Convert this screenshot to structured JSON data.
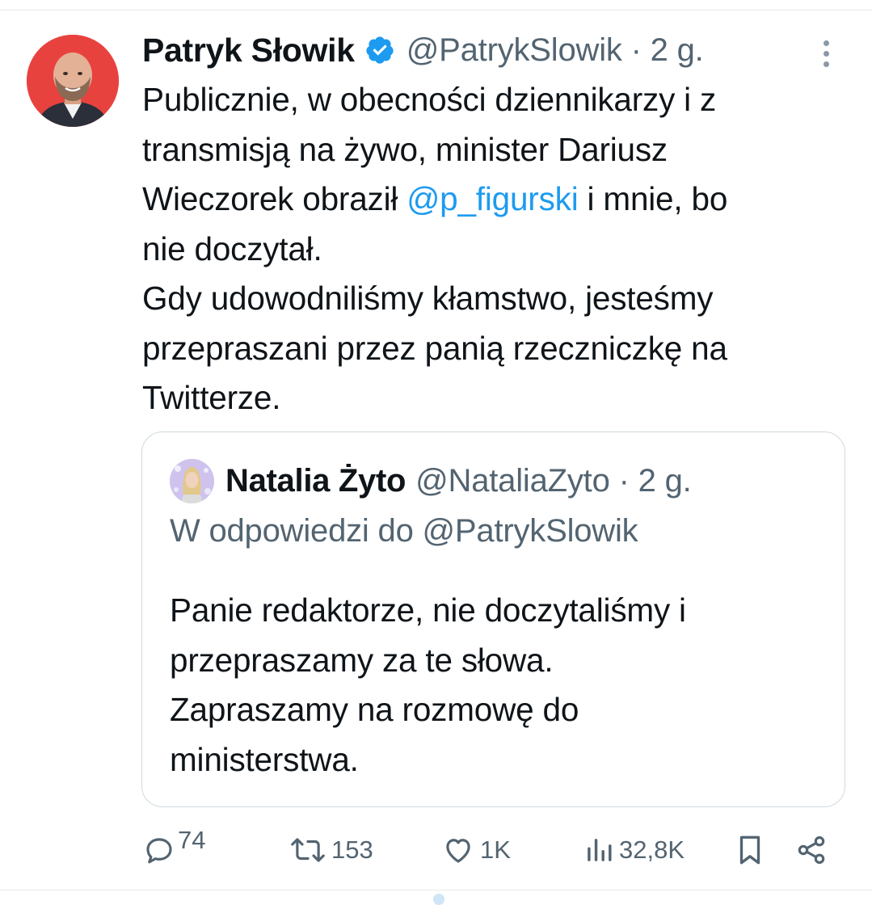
{
  "tweet": {
    "author": {
      "display_name": "Patryk Słowik",
      "verified": true,
      "handle": "@PatrykSlowik",
      "time": "2 g.",
      "avatar_bg": "#e8423f"
    },
    "separator": "·",
    "text_lines": [
      {
        "text": "Publicznie, w obecności dziennikarzy i z"
      },
      {
        "text": "transmisją na żywo, minister Dariusz"
      },
      {
        "before": "Wieczorek obraził ",
        "mention": "@p_figurski",
        "after": " i mnie, bo"
      },
      {
        "text": "nie doczytał."
      },
      {
        "text": "Gdy udowodniliśmy kłamstwo, jesteśmy"
      },
      {
        "text": "przepraszani przez panią rzeczniczkę na"
      },
      {
        "text": "Twitterze."
      }
    ],
    "more_icon": "more-vertical-icon"
  },
  "quote": {
    "author": {
      "display_name": "Natalia Żyto",
      "handle": "@NataliaZyto",
      "time": "2 g."
    },
    "reply_to": "W odpowiedzi do @PatrykSlowik",
    "text_lines": [
      "Panie redaktorze, nie doczytaliśmy i",
      "przepraszamy za te słowa.",
      "Zapraszamy na rozmowę do",
      "ministerstwa."
    ]
  },
  "actions": {
    "replies": "74",
    "retweets": "153",
    "likes": "1K",
    "views": "32,8K",
    "icons": [
      "reply-icon",
      "retweet-icon",
      "like-icon",
      "views-icon",
      "bookmark-icon",
      "share-icon"
    ]
  },
  "colors": {
    "text": "#0f1419",
    "secondary": "#536471",
    "accent": "#1d9bf0",
    "border": "#cfd9de"
  }
}
